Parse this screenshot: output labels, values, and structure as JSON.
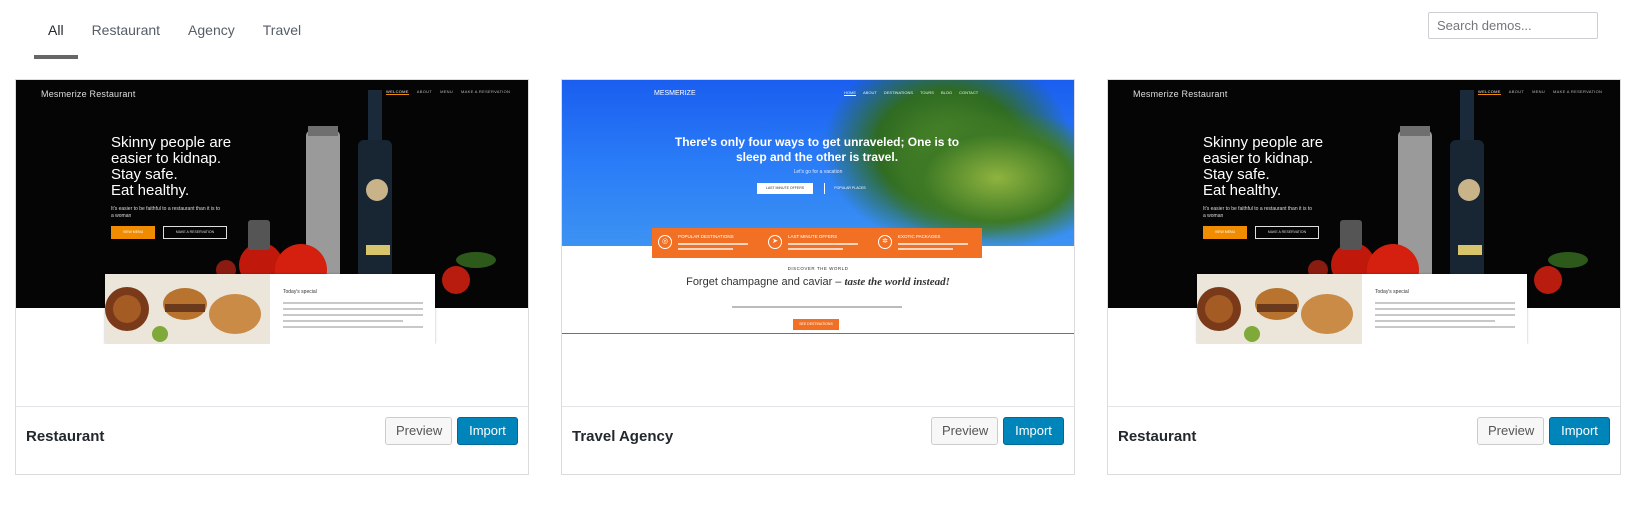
{
  "filters": {
    "tabs": [
      {
        "label": "All",
        "active": true
      },
      {
        "label": "Restaurant",
        "active": false
      },
      {
        "label": "Agency",
        "active": false
      },
      {
        "label": "Travel",
        "active": false
      }
    ]
  },
  "search": {
    "placeholder": "Search demos..."
  },
  "buttons": {
    "preview": "Preview",
    "import": "Import"
  },
  "cards": [
    {
      "title": "Restaurant",
      "screenshot": {
        "logo": "Mesmerize Restaurant",
        "nav": [
          "WELCOME",
          "ABOUT",
          "MENU",
          "MAKE A RESERVATION"
        ],
        "hero_lines": [
          "Skinny people are",
          "easier to kidnap.",
          "Stay safe.",
          "Eat healthy."
        ],
        "subtext": "It's easier to be faithful to a restaurant than it is to a woman",
        "cta_primary": "VIEW MENU",
        "cta_secondary": "MAKE A RESERVATION",
        "card_title": "Today's special"
      }
    },
    {
      "title": "Travel Agency",
      "screenshot": {
        "logo": "MESMERIZE",
        "nav": [
          "HOME",
          "ABOUT",
          "DESTINATIONS",
          "TOURS",
          "BLOG",
          "CONTACT"
        ],
        "hero": "There's only four ways to get unraveled; One is to sleep and the other is travel.",
        "subtext": "Let's go for a vacation",
        "cta_primary": "LAST MINUTE OFFERS",
        "cta_secondary": "POPULAR PLACES",
        "features": [
          "POPULAR DESTINATIONS",
          "LAST MINUTE OFFERS",
          "EXOTIC PACKAGES"
        ],
        "discover": "DISCOVER THE WORLD",
        "headline_plain": "Forget champagne and caviar – ",
        "headline_italic": "taste the world instead!",
        "cta_bottom": "SEE DESTINATIONS"
      }
    },
    {
      "title": "Restaurant",
      "screenshot": {
        "logo": "Mesmerize Restaurant",
        "nav": [
          "WELCOME",
          "ABOUT",
          "MENU",
          "MAKE A RESERVATION"
        ],
        "hero_lines": [
          "Skinny people are",
          "easier to kidnap.",
          "Stay safe.",
          "Eat healthy."
        ],
        "subtext": "It's easier to be faithful to a restaurant than it is to a woman",
        "cta_primary": "VIEW MENU",
        "cta_secondary": "MAKE A RESERVATION",
        "card_title": "Today's special"
      }
    }
  ],
  "colors": {
    "import_button": "#0085ba",
    "restaurant_accent": "#f08c00",
    "travel_accent": "#f27024",
    "travel_sky": "#1a5ef0"
  }
}
